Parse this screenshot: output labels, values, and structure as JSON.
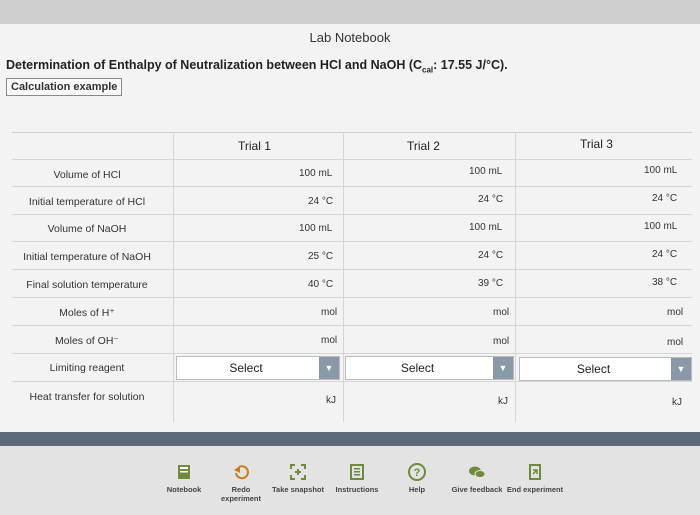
{
  "window_title": "Lab Notebook",
  "heading": "Determination of Enthalpy of Neutralization between HCl and NaOH (C",
  "heading_sub": "cal",
  "heading_tail": ": 17.55 J/°C).",
  "calc_example": "Calculation example",
  "trials": [
    "Trial 1",
    "Trial 2",
    "Trial 3"
  ],
  "rows": [
    {
      "label": "Volume of HCl",
      "values": [
        "100 mL",
        "100 mL",
        "100 mL"
      ]
    },
    {
      "label": "Initial temperature of HCl",
      "values": [
        "24 °C",
        "24 °C",
        "24 °C"
      ]
    },
    {
      "label": "Volume of NaOH",
      "values": [
        "100 mL",
        "100 mL",
        "100 mL"
      ]
    },
    {
      "label": "Initial temperature of NaOH",
      "values": [
        "25 °C",
        "24 °C",
        "24 °C"
      ]
    },
    {
      "label": "Final solution temperature",
      "values": [
        "40 °C",
        "39 °C",
        "38 °C"
      ]
    },
    {
      "label": "Moles of H⁺",
      "values": [
        "mol",
        "mol",
        "mol"
      ]
    },
    {
      "label": "Moles of OH⁻",
      "values": [
        "mol",
        "mol",
        "mol"
      ]
    },
    {
      "label": "Limiting reagent",
      "values": [
        "Select",
        "Select",
        "Select"
      ]
    },
    {
      "label": "Heat transfer for solution",
      "values": [
        "kJ",
        "kJ",
        "kJ"
      ]
    }
  ],
  "toolbar": [
    {
      "label": "Notebook",
      "icon": "notebook-icon"
    },
    {
      "label": "Redo experiment",
      "icon": "redo-icon"
    },
    {
      "label": "Take snapshot",
      "icon": "snapshot-icon"
    },
    {
      "label": "Instructions",
      "icon": "instructions-icon"
    },
    {
      "label": "Help",
      "icon": "help-icon"
    },
    {
      "label": "Give feedback",
      "icon": "feedback-icon"
    },
    {
      "label": "End experiment",
      "icon": "end-experiment-icon"
    }
  ]
}
